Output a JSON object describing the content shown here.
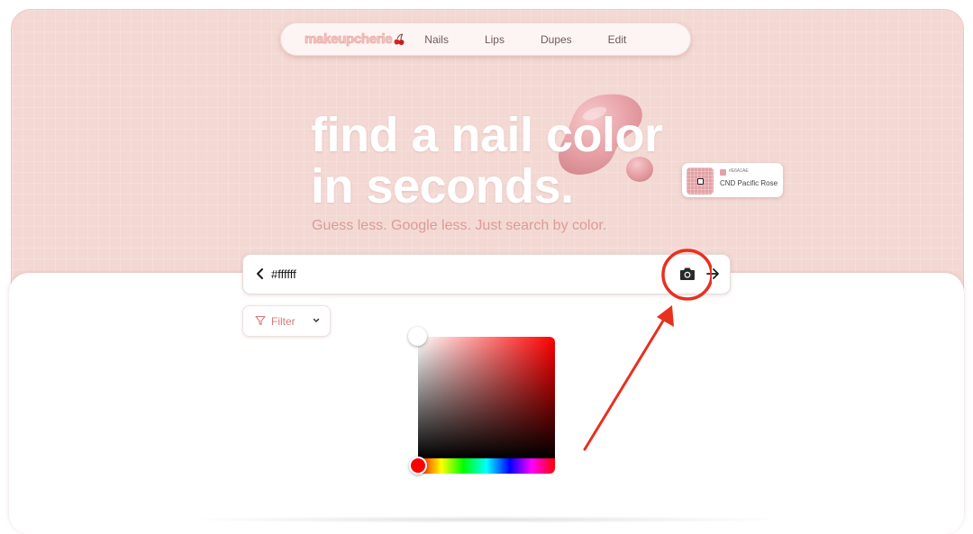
{
  "nav": {
    "logo": "makeupcherie",
    "links": [
      "Nails",
      "Lips",
      "Dupes",
      "Edit"
    ]
  },
  "hero": {
    "headline_line1": "find a nail color",
    "headline_line2": "in seconds.",
    "subhead": "Guess less. Google less. Just search by color."
  },
  "swatch_card": {
    "hex": "#E6A1AE",
    "name": "CND Pacific Rose"
  },
  "search": {
    "value": "#ffffff"
  },
  "filter": {
    "label": "Filter"
  },
  "colors": {
    "hero_bg": "#f3d8d3",
    "accent": "#d27b78",
    "annotation": "#e8301f",
    "picker_hue": "#ff0000"
  },
  "icons": [
    "cherry-icon",
    "back-icon",
    "camera-icon",
    "arrow-right-icon",
    "filter-icon",
    "chevron-down-icon"
  ]
}
